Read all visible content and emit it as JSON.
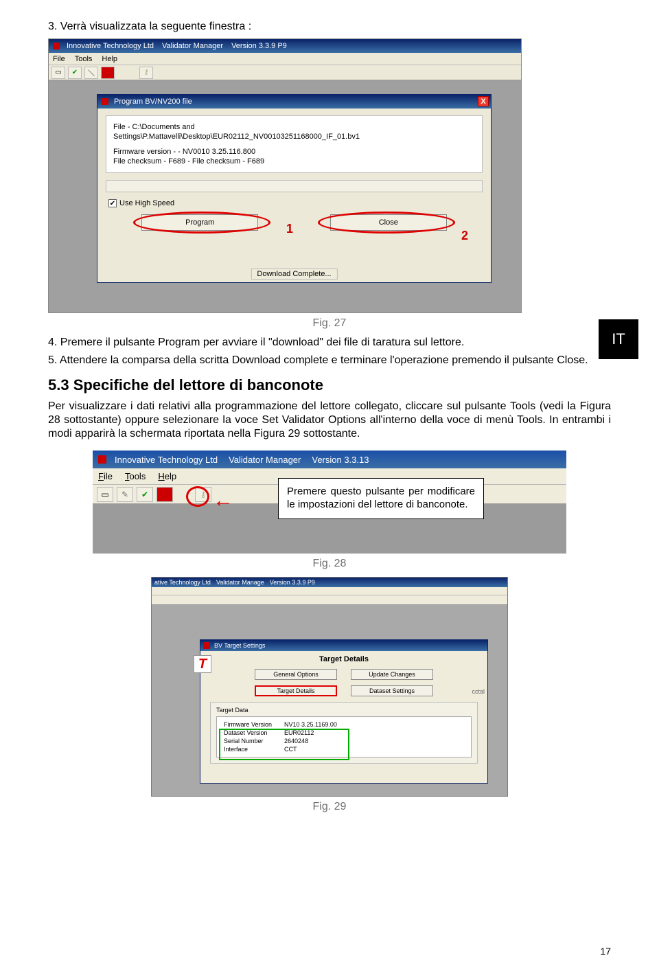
{
  "steps": {
    "s3": "3.  Verrà visualizzata la seguente finestra :",
    "s4_pre": "4.  Premere il pulsante ",
    "s4_word": "Program",
    "s4_post": " per avviare il \"download\" dei file di taratura sul lettore.",
    "s5": "5.  Attendere la comparsa della scritta Download complete e terminare l'operazione premendo il pulsante Close."
  },
  "section53": "5.3 Specifiche del lettore di banconote",
  "para53": "Per visualizzare i dati relativi alla programmazione del lettore collegato, cliccare sul pulsante Tools (vedi la Figura 28 sottostante) oppure selezionare la voce Set Validator Options all'interno della voce di menù Tools. In entrambi i modi apparirà la schermata riportata nella Figura 29 sottostante.",
  "IT": "IT",
  "fig27": {
    "caption": "Fig. 27",
    "title_a": "Innovative Technology Ltd",
    "title_b": "Validator Manager",
    "title_c": "Version 3.3.9  P9",
    "menu": {
      "file": "File",
      "tools": "Tools",
      "help": "Help"
    },
    "inner_title": "Program BV/NV200 file",
    "file_line1": "File - C:\\Documents and",
    "file_line2": "Settings\\P.Mattavelli\\Desktop\\EUR02112_NV00103251168000_IF_01.bv1",
    "fw_line": "Firmware version - - NV0010 3.25.116.800",
    "chk_line": "File checksum - F689 - File checksum - F689",
    "use_high_speed": "Use High Speed",
    "program_btn": "Program",
    "close_btn": "Close",
    "num1": "1",
    "num2": "2",
    "dlc": "Download Complete..."
  },
  "fig28": {
    "caption": "Fig. 28",
    "title_a": "Innovative Technology Ltd",
    "title_b": "Validator Manager",
    "title_c": "Version 3.3.13",
    "menu": {
      "file": "File",
      "tools": "Tools",
      "help": "Help"
    },
    "callout": "Premere questo pulsante per modificare le impostazioni del lettore di banconote."
  },
  "fig29": {
    "caption": "Fig. 29",
    "title_a": "ative Technology Ltd",
    "title_b": "Validator Manage",
    "title_c": "Version 3.3.9  P9",
    "inner_title": "BV Target Settings",
    "heading": "Target Details",
    "tabs": {
      "general": "General Options",
      "update": "Update Changes",
      "target": "Target Details",
      "dataset": "Dataset Settings",
      "cut": "cctal"
    },
    "group_title": "Target Data",
    "rows": {
      "r1k": "Firmware Version",
      "r1v": "NV10 3.25.1169.00",
      "r2k": "Dataset Version",
      "r2v": "EUR02112",
      "r3k": "Serial Number",
      "r3v": "2640248",
      "r4k": "Interface",
      "r4v": "CCT"
    }
  },
  "page": "17"
}
